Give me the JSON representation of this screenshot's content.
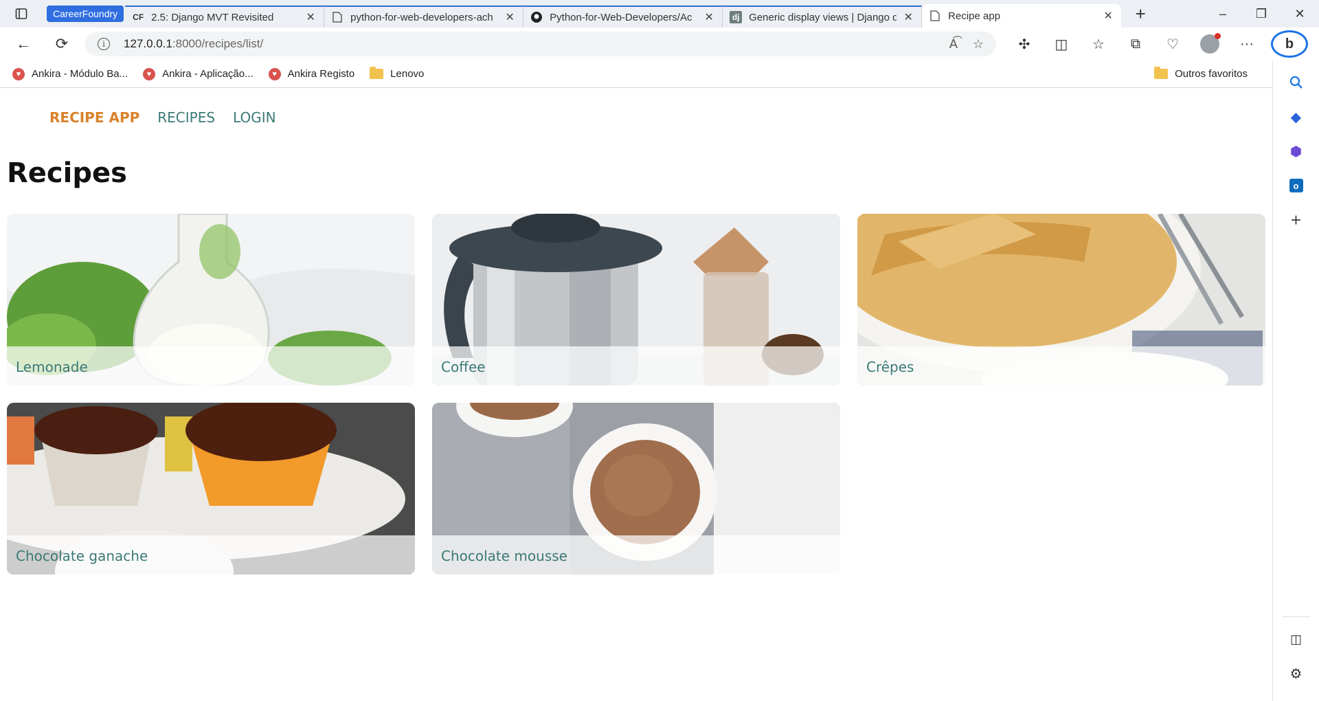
{
  "browser": {
    "group_label": "CareerFoundry",
    "tabs": [
      {
        "title": "2.5: Django MVT Revisited",
        "icon": "CF"
      },
      {
        "title": "python-for-web-developers-ach",
        "icon": "page"
      },
      {
        "title": "Python-for-Web-Developers/Ac",
        "icon": "github"
      },
      {
        "title": "Generic display views | Django d",
        "icon": "dj"
      },
      {
        "title": "Recipe app",
        "icon": "page"
      }
    ],
    "url_host": "127.0.0.1",
    "url_rest": ":8000/recipes/list/",
    "bookmarks": [
      {
        "label": "Ankira - Módulo Ba..."
      },
      {
        "label": "Ankira - Aplicação..."
      },
      {
        "label": "Ankira Registo"
      },
      {
        "label": "Lenovo"
      }
    ],
    "other_favorites": "Outros favoritos"
  },
  "nav": {
    "brand": "RECIPE APP",
    "recipes": "RECIPES",
    "login": "LOGIN"
  },
  "page_title": "Recipes",
  "recipes": [
    {
      "name": "Lemonade"
    },
    {
      "name": "Coffee"
    },
    {
      "name": "Crêpes"
    },
    {
      "name": "Chocolate ganache"
    },
    {
      "name": "Chocolate mousse"
    }
  ]
}
